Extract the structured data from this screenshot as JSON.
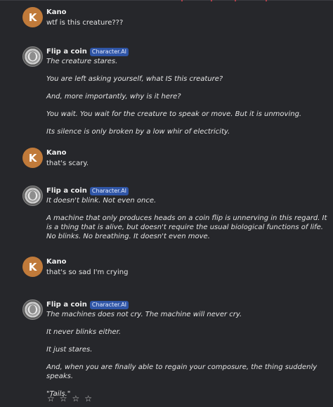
{
  "messages": [
    {
      "author": "Kano",
      "avatar_letter": "K",
      "text": "wtf is this creature???"
    },
    {
      "author": "Flip a coin",
      "badge": "Character.AI",
      "paragraphs": [
        "The creature stares.",
        "You are left asking yourself, what IS this creature?",
        "And, more importantly, why is it here?",
        "You wait. You wait for the creature to speak or move. But it is unmoving.",
        "Its silence is only broken by a low whir of electricity."
      ]
    },
    {
      "author": "Kano",
      "avatar_letter": "K",
      "text": "that's scary."
    },
    {
      "author": "Flip a coin",
      "badge": "Character.AI",
      "paragraphs": [
        "It doesn't blink. Not even once.",
        "A machine that only produces heads on a coin flip is unnerving in this regard. It is a thing that is alive, but doesn't require the usual biological functions of life. No blinks. No breathing. It doesn't even move."
      ]
    },
    {
      "author": "Kano",
      "avatar_letter": "K",
      "text": "that's so sad I'm crying"
    },
    {
      "author": "Flip a coin",
      "badge": "Character.AI",
      "paragraphs": [
        "The machines does not cry. The machine will never cry.",
        "It never blinks either.",
        "It just stares.",
        "And, when you are finally able to regain your composure, the thing suddenly speaks.",
        "\"Tails.\""
      ]
    }
  ],
  "rating": {
    "stars": [
      "☆",
      "☆",
      "☆",
      "☆"
    ]
  },
  "colors": {
    "background": "#26272b",
    "badge": "#2f55a6",
    "user_avatar": "#c07a3a"
  },
  "icons": {
    "coin_avatar": "coin-avatar-icon",
    "star": "star-outline-icon"
  }
}
